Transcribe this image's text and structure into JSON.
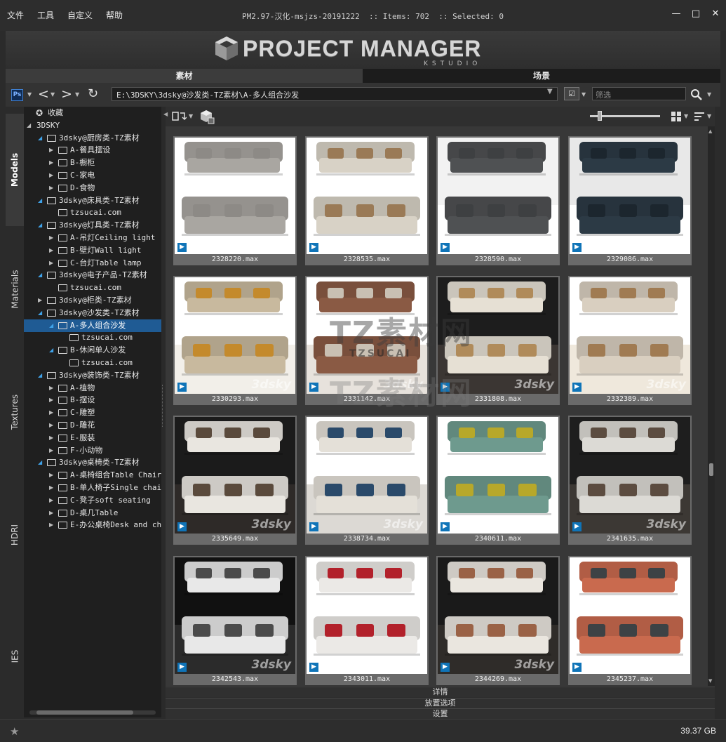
{
  "menu": [
    "文件",
    "工具",
    "自定义",
    "帮助"
  ],
  "window": {
    "title": "PM2.97-汉化-msjzs-20191222  :: Items: 702  :: Selected: 0",
    "min": "—",
    "max": "□",
    "close": "✕"
  },
  "logo": {
    "title": "PROJECT MANAGER",
    "sub": "KSTUDIO"
  },
  "main_tabs": [
    {
      "label": "素材",
      "active": true
    },
    {
      "label": "场景",
      "active": false
    }
  ],
  "toolbar": {
    "ps_label": "Ps",
    "path": "E:\\3DSKY\\3dsky@沙发类-TZ素材\\A-多人组合沙发",
    "filter_placeholder": "筛选"
  },
  "side_tabs": [
    {
      "label": "Models",
      "active": true
    },
    {
      "label": "Materials",
      "active": false
    },
    {
      "label": "Textures",
      "active": false
    },
    {
      "label": "HDRI",
      "active": false
    },
    {
      "label": "IES",
      "active": false
    }
  ],
  "tree": [
    {
      "label": "收藏",
      "depth": 0,
      "icon": "star",
      "toggle": ""
    },
    {
      "label": "3DSKY",
      "depth": 0,
      "icon": "none",
      "toggle": "open"
    },
    {
      "label": "3dsky@厨房类-TZ素材",
      "depth": 1,
      "icon": "folder",
      "toggle": "open"
    },
    {
      "label": "A-餐具摆设",
      "depth": 2,
      "icon": "folder",
      "toggle": "closed"
    },
    {
      "label": "B-橱柜",
      "depth": 2,
      "icon": "folder",
      "toggle": "closed"
    },
    {
      "label": "C-家电",
      "depth": 2,
      "icon": "folder",
      "toggle": "closed"
    },
    {
      "label": "D-食物",
      "depth": 2,
      "icon": "folder",
      "toggle": "closed"
    },
    {
      "label": "3dsky@床具类-TZ素材",
      "depth": 1,
      "icon": "folder",
      "toggle": "open"
    },
    {
      "label": "tzsucai.com",
      "depth": 2,
      "icon": "folder",
      "toggle": ""
    },
    {
      "label": "3dsky@灯具类-TZ素材",
      "depth": 1,
      "icon": "folder",
      "toggle": "open"
    },
    {
      "label": "A-吊灯Ceiling light",
      "depth": 2,
      "icon": "folder",
      "toggle": "closed"
    },
    {
      "label": "B-壁灯Wall light",
      "depth": 2,
      "icon": "folder",
      "toggle": "closed"
    },
    {
      "label": "C-台灯Table lamp",
      "depth": 2,
      "icon": "folder",
      "toggle": "closed"
    },
    {
      "label": "3dsky@电子产品-TZ素材",
      "depth": 1,
      "icon": "folder",
      "toggle": "open"
    },
    {
      "label": "tzsucai.com",
      "depth": 2,
      "icon": "folder",
      "toggle": ""
    },
    {
      "label": "3dsky@柜类-TZ素材",
      "depth": 1,
      "icon": "folder",
      "toggle": "closed"
    },
    {
      "label": "3dsky@沙发类-TZ素材",
      "depth": 1,
      "icon": "folder",
      "toggle": "open"
    },
    {
      "label": "A-多人组合沙发",
      "depth": 2,
      "icon": "folder",
      "toggle": "open",
      "selected": true
    },
    {
      "label": "tzsucai.com",
      "depth": 3,
      "icon": "folder",
      "toggle": ""
    },
    {
      "label": "B-休闲单人沙发",
      "depth": 2,
      "icon": "folder",
      "toggle": "open"
    },
    {
      "label": "tzsucai.com",
      "depth": 3,
      "icon": "folder",
      "toggle": ""
    },
    {
      "label": "3dsky@装饰类-TZ素材",
      "depth": 1,
      "icon": "folder",
      "toggle": "open"
    },
    {
      "label": "A-植物",
      "depth": 2,
      "icon": "folder",
      "toggle": "closed"
    },
    {
      "label": "B-摆设",
      "depth": 2,
      "icon": "folder",
      "toggle": "closed"
    },
    {
      "label": "C-雕塑",
      "depth": 2,
      "icon": "folder",
      "toggle": "closed"
    },
    {
      "label": "D-雕花",
      "depth": 2,
      "icon": "folder",
      "toggle": "closed"
    },
    {
      "label": "E-服装",
      "depth": 2,
      "icon": "folder",
      "toggle": "closed"
    },
    {
      "label": "F-小动物",
      "depth": 2,
      "icon": "folder",
      "toggle": "closed"
    },
    {
      "label": "3dsky@桌椅类-TZ素材",
      "depth": 1,
      "icon": "folder",
      "toggle": "open"
    },
    {
      "label": "A-桌椅组合Table Chair",
      "depth": 2,
      "icon": "folder",
      "toggle": "closed"
    },
    {
      "label": "B-单人椅子Single chair",
      "depth": 2,
      "icon": "folder",
      "toggle": "closed"
    },
    {
      "label": "C-凳子soft seating",
      "depth": 2,
      "icon": "folder",
      "toggle": "closed"
    },
    {
      "label": "D-桌几Table",
      "depth": 2,
      "icon": "folder",
      "toggle": "closed"
    },
    {
      "label": "E-办公桌椅Desk and chair",
      "depth": 2,
      "icon": "folder",
      "toggle": "closed"
    }
  ],
  "thumbnails": [
    {
      "name": "2328220.max",
      "bg": "#ffffff",
      "floor": "#ffffff",
      "sofa": "#a9a6a1",
      "accent": "#8d8a86",
      "badge": "3ds-max-icon"
    },
    {
      "name": "2328535.max",
      "bg": "#ffffff",
      "floor": "#ffffff",
      "sofa": "#d8d2c6",
      "accent": "#9a7a56",
      "badge": "3ds-max-icon"
    },
    {
      "name": "2328590.max",
      "bg": "#f2f2f2",
      "floor": "#ffffff",
      "sofa": "#4f5153",
      "accent": "#3e4042",
      "badge": "3ds-max-icon"
    },
    {
      "name": "2329086.max",
      "bg": "#e8e8e8",
      "floor": "#ffffff",
      "sofa": "#2c3a45",
      "accent": "#1c262e",
      "badge": "3ds-max-icon"
    },
    {
      "name": "2330293.max",
      "bg": "#ffffff",
      "floor": "#f2efe9",
      "sofa": "#c8b99e",
      "accent": "#c48a2c",
      "badge": "3ds-max-icon"
    },
    {
      "name": "2331142.max",
      "bg": "#ffffff",
      "floor": "#e7e2dc",
      "sofa": "#8a5a44",
      "accent": "#c9c0b3",
      "badge": "3ds-max-icon"
    },
    {
      "name": "2331808.max",
      "bg": "#1d1d1d",
      "floor": "#3b3633",
      "sofa": "#e6e0d4",
      "accent": "#b08b5a",
      "badge": "3ds-max-icon"
    },
    {
      "name": "2332389.max",
      "bg": "#ffffff",
      "floor": "#efe8dc",
      "sofa": "#d9cfc0",
      "accent": "#a07b52",
      "badge": "3ds-max-icon"
    },
    {
      "name": "2335649.max",
      "bg": "#1b1b1b",
      "floor": "#2e2a28",
      "sofa": "#e9e6e0",
      "accent": "#5a4a3c",
      "badge": "3ds-max-icon"
    },
    {
      "name": "2338734.max",
      "bg": "#ffffff",
      "floor": "#dcd9d4",
      "sofa": "#e4e0d8",
      "accent": "#2a4a6a",
      "badge": "3ds-max-icon"
    },
    {
      "name": "2340611.max",
      "bg": "#ffffff",
      "floor": "#ffffff",
      "sofa": "#6e9a8e",
      "accent": "#b7a82a",
      "badge": "3ds-max-icon"
    },
    {
      "name": "2341635.max",
      "bg": "#1e1e1e",
      "floor": "#3c3834",
      "sofa": "#dcdad5",
      "accent": "#5c4c40",
      "badge": "3ds-max-icon"
    },
    {
      "name": "2342543.max",
      "bg": "#111111",
      "floor": "#2b2b2b",
      "sofa": "#e8e8e8",
      "accent": "#4b4b4b",
      "badge": "3ds-max-icon"
    },
    {
      "name": "2343011.max",
      "bg": "#ffffff",
      "floor": "#ffffff",
      "sofa": "#ebe9e6",
      "accent": "#b2212b",
      "badge": "3ds-max-icon"
    },
    {
      "name": "2344269.max",
      "bg": "#1a1a1a",
      "floor": "#2f2c29",
      "sofa": "#eae6df",
      "accent": "#9a6246",
      "badge": "3ds-max-icon"
    },
    {
      "name": "2345237.max",
      "bg": "#ffffff",
      "floor": "#ffffff",
      "sofa": "#c96a4e",
      "accent": "#3d4245",
      "badge": "3ds-max-icon"
    }
  ],
  "watermark": {
    "cn": "TZ素材网",
    "latin": "TZSUCAI",
    "cn2": "TZ素材网",
    "dotcom": ".COM"
  },
  "tile_watermark": "3dsky",
  "panels": [
    "详情",
    "放置选项",
    "设置"
  ],
  "status": {
    "disk": "39.37 GB"
  }
}
